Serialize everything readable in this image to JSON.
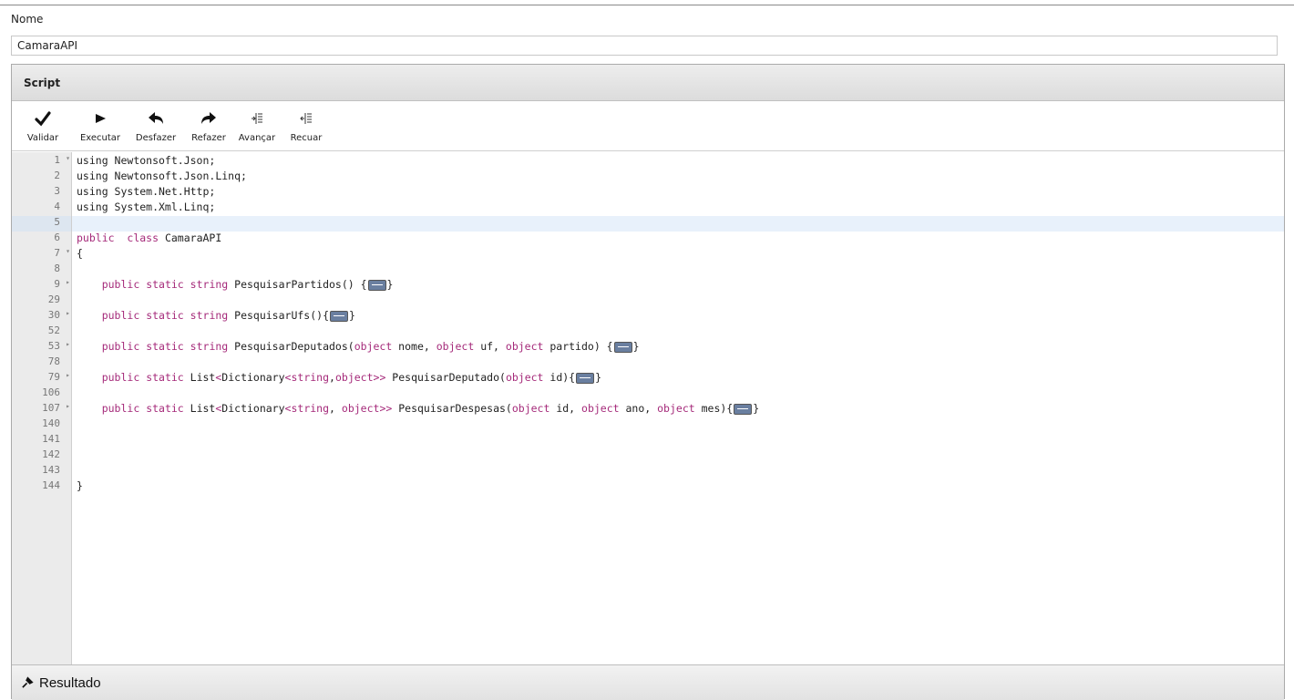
{
  "form": {
    "name_label": "Nome",
    "name_value": "CamaraAPI"
  },
  "panel": {
    "title": "Script"
  },
  "toolbar": {
    "buttons": [
      {
        "label": "Validar",
        "icon": "checkmark-icon"
      },
      {
        "label": "Executar",
        "icon": "play-icon"
      },
      {
        "label": "Desfazer",
        "icon": "undo-icon"
      },
      {
        "label": "Refazer",
        "icon": "redo-icon"
      },
      {
        "label": "Avançar",
        "icon": "indent-icon"
      },
      {
        "label": "Recuar",
        "icon": "outdent-icon"
      }
    ]
  },
  "editor": {
    "lines": [
      {
        "num": "1",
        "fold": "▾",
        "code": "using Newtonsoft.Json;"
      },
      {
        "num": "2",
        "fold": "",
        "code": "using Newtonsoft.Json.Linq;"
      },
      {
        "num": "3",
        "fold": "",
        "code": "using System.Net.Http;"
      },
      {
        "num": "4",
        "fold": "",
        "code": "using System.Xml.Linq;"
      },
      {
        "num": "5",
        "fold": "",
        "code": ""
      },
      {
        "num": "6",
        "fold": "",
        "code": "public  class CamaraAPI"
      },
      {
        "num": "7",
        "fold": "▾",
        "code": "{"
      },
      {
        "num": "8",
        "fold": "",
        "code": ""
      },
      {
        "num": "9",
        "fold": "▸",
        "code": "    public static string PesquisarPartidos() {⟺}"
      },
      {
        "num": "29",
        "fold": "",
        "code": ""
      },
      {
        "num": "30",
        "fold": "▸",
        "code": "    public static string PesquisarUfs(){⟺}"
      },
      {
        "num": "52",
        "fold": "",
        "code": ""
      },
      {
        "num": "53",
        "fold": "▸",
        "code": "    public static string PesquisarDeputados(object nome, object uf, object partido) {⟺}"
      },
      {
        "num": "78",
        "fold": "",
        "code": ""
      },
      {
        "num": "79",
        "fold": "▸",
        "code": "    public static List<Dictionary<string,object>> PesquisarDeputado(object id){⟺}"
      },
      {
        "num": "106",
        "fold": "",
        "code": ""
      },
      {
        "num": "107",
        "fold": "▸",
        "code": "    public static List<Dictionary<string, object>> PesquisarDespesas(object id, object ano, object mes){⟺}"
      },
      {
        "num": "140",
        "fold": "",
        "code": ""
      },
      {
        "num": "141",
        "fold": "",
        "code": ""
      },
      {
        "num": "142",
        "fold": "",
        "code": ""
      },
      {
        "num": "143",
        "fold": "",
        "code": ""
      },
      {
        "num": "144",
        "fold": "",
        "code": "}"
      }
    ],
    "highlighted_line": "5",
    "keyword_color": "#a52a7a"
  },
  "result": {
    "label": "Resultado",
    "icon": "pin-icon"
  }
}
